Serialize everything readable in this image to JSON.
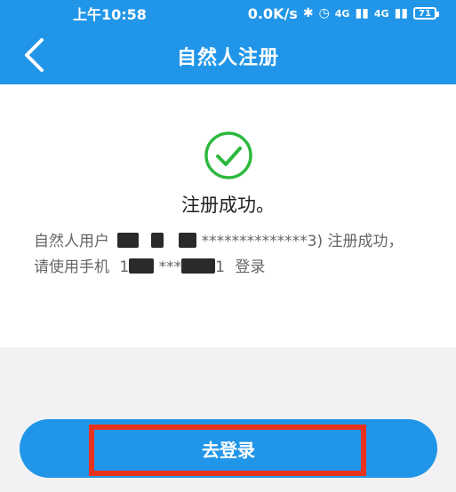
{
  "statusbar": {
    "time": "上午10:58",
    "speed": "0.0K/s",
    "signal_a": "4G",
    "signal_b": "4G",
    "battery": "71"
  },
  "navbar": {
    "title": "自然人注册",
    "back_icon": "chevron-left-icon"
  },
  "result": {
    "icon": "check-circle-icon",
    "title": "注册成功。",
    "message_prefix": "自然人用户",
    "masked_id_tail": "**************3)",
    "message_suffix": "注册成功，",
    "phone_prefix": "请使用手机",
    "phone_mask": "***",
    "phone_tail": "1",
    "login_word": "登录"
  },
  "action": {
    "login_label": "去登录"
  },
  "colors": {
    "primary": "#2196e8",
    "success": "#2db83d",
    "highlight": "#e8321d"
  }
}
